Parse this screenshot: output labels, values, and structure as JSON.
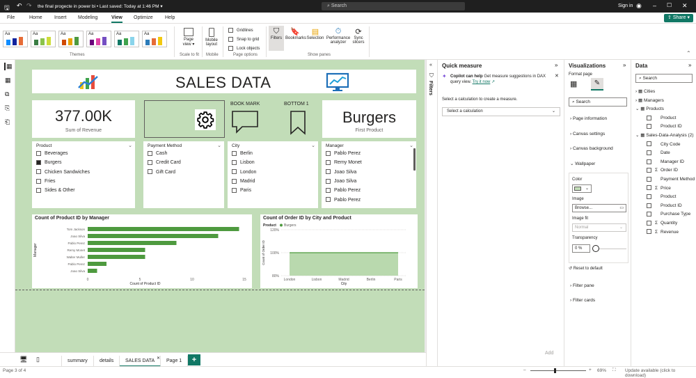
{
  "titlebar": {
    "file_name": "the final progecte in power bi",
    "saved": "Last saved: Today at 1:46 PM",
    "search_placeholder": "Search",
    "sign_in": "Sign in"
  },
  "ribbon_tabs": [
    "File",
    "Home",
    "Insert",
    "Modeling",
    "View",
    "Optimize",
    "Help"
  ],
  "share_label": "Share",
  "ribbon": {
    "themes_label": "Themes",
    "theme_tile_text": "Aa",
    "page_view": "Page view",
    "scale_label": "Scale to fit",
    "mobile_layout": "Mobile layout",
    "mobile_label": "Mobile",
    "gridlines": "Gridlines",
    "snap": "Snap to grid",
    "lock": "Lock objects",
    "page_options": "Page options",
    "filters": "Filters",
    "bookmarks": "Bookmarks",
    "selection": "Selection",
    "performance": "Performance analyzer",
    "sync": "Sync slicers",
    "show_panes": "Show panes"
  },
  "report": {
    "title": "SALES DATA",
    "kpi_revenue": "377.00K",
    "kpi_revenue_label": "Sum of Revenue",
    "bookmark_label": "BOOK MARK",
    "bottom_label": "BOTTOM 1",
    "first_product": "Burgers",
    "first_product_label": "First Product",
    "slicers": {
      "product": {
        "title": "Product",
        "items": [
          "Beverages",
          "Burgers",
          "Chicken Sandwiches",
          "Fries",
          "Sides & Other"
        ]
      },
      "payment": {
        "title": "Payment Method",
        "items": [
          "Cash",
          "Credit Card",
          "Gift Card"
        ]
      },
      "city": {
        "title": "City",
        "items": [
          "Berlin",
          "Lisbon",
          "London",
          "Madrid",
          "Paris"
        ]
      },
      "manager": {
        "title": "Manager",
        "items": [
          "Pablo Perez",
          "Remy Monet",
          "Joao Silva",
          "Joao Silva",
          "Pablo Perez",
          "Pablo Perez"
        ]
      }
    }
  },
  "chart_data": [
    {
      "type": "bar",
      "title": "Count of Product ID by Manager",
      "xlabel": "Count of Product ID",
      "ylabel": "Manager",
      "categories": [
        "Tom Jackson",
        "Joao Silva",
        "Pablo Perez",
        "Remy Monet",
        "Walter Muller",
        "Pablo Perez",
        "Joao Silva"
      ],
      "values": [
        14.5,
        12.5,
        8.5,
        5.5,
        5.5,
        1.8,
        0.9
      ],
      "xlim": [
        0,
        15
      ],
      "xticks": [
        "0",
        "5",
        "10",
        "15"
      ]
    },
    {
      "type": "area",
      "title": "Count of Order ID by City and Product",
      "xlabel": "City",
      "ylabel": "Count of Order ID",
      "legend_title": "Product",
      "categories": [
        "London",
        "Lisbon",
        "Madrid",
        "Berlin",
        "Paris"
      ],
      "series": [
        {
          "name": "Burgers",
          "values": [
            100,
            100,
            100,
            100,
            100
          ]
        }
      ],
      "ylim": [
        80,
        120
      ],
      "yticks": [
        "120%",
        "100%",
        "80%"
      ]
    }
  ],
  "report_tabs": [
    "summary",
    "details",
    "SALES DATA",
    "Page 1"
  ],
  "status": {
    "page": "Page 3 of 4",
    "zoom": "69%",
    "update": "Update available (click to download)"
  },
  "filters_label": "Filters",
  "quick_measure": {
    "title": "Quick measure",
    "copilot_title": "Copilot can help",
    "copilot_text": "Get measure suggestions in DAX query view.",
    "try_now": "Try it now",
    "select_prompt": "Select a calculation to create a measure.",
    "select_placeholder": "Select a calculation",
    "add": "Add"
  },
  "viz": {
    "title": "Visualizations",
    "format_page": "Format page",
    "search": "Search",
    "sections": [
      "Page information",
      "Canvas settings",
      "Canvas background",
      "Wallpaper"
    ],
    "color": "Color",
    "image": "Image",
    "browse": "Browse...",
    "image_fit": "Image fit",
    "fit_value": "Normal",
    "transparency": "Transparency",
    "transparency_value": "0 %",
    "reset": "Reset to default",
    "bottom_sections": [
      "Filter pane",
      "Filter cards"
    ],
    "wallpaper_color": "#c2ddb8"
  },
  "data_panel": {
    "title": "Data",
    "search": "Search",
    "tables": [
      {
        "name": "Cities",
        "expanded": false,
        "fields": []
      },
      {
        "name": "Managers",
        "expanded": false,
        "fields": []
      },
      {
        "name": "Products",
        "expanded": true,
        "fields": [
          "Product",
          "Product ID"
        ]
      },
      {
        "name": "Sales-Data-Analysis (2)",
        "expanded": true,
        "fields": [
          "City Code",
          "Date",
          "Manager ID",
          "Order ID",
          "Payment Method",
          "Price",
          "Product",
          "Product ID",
          "Purchase Type",
          "Quantity",
          "Revenue"
        ]
      }
    ]
  },
  "colors": {
    "accent": "#117865",
    "bar": "#4e9a3f",
    "page_bg": "#c2ddb8"
  }
}
